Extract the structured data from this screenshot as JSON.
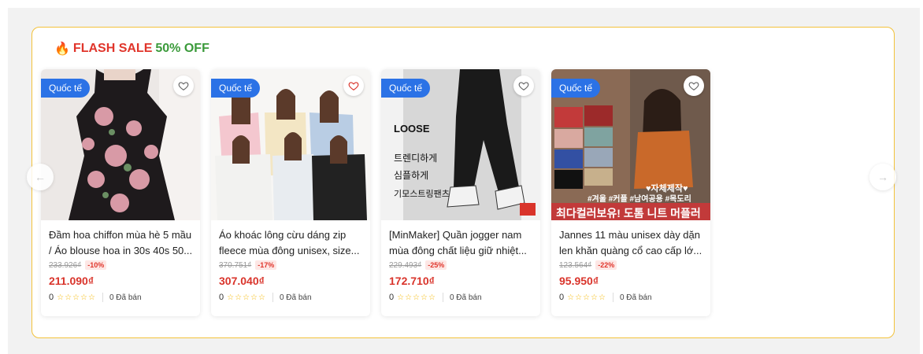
{
  "flash_sale": {
    "fire_icon": "🔥",
    "title_red": "FLASH SALE",
    "title_green": "50% OFF",
    "prev_arrow": "←",
    "next_arrow": "→"
  },
  "colors": {
    "border": "#f3c23a",
    "red": "#e0352b",
    "green": "#3a9a3a",
    "badge": "#2b72e6"
  },
  "products": [
    {
      "badge": "Quốc tế",
      "name": "Đầm hoa chiffon mùa hè 5 mầu / Áo blouse hoa in 30s 40s 50...",
      "old_price": "233.926₫",
      "discount": "-10%",
      "price": "211.090₫",
      "rating": "0",
      "stars": "☆☆☆☆☆",
      "sold": "0 Đã bán",
      "image_text": []
    },
    {
      "badge": "Quốc tế",
      "name": "Áo khoác lông cừu dáng zip fleece mùa đông unisex, size...",
      "old_price": "370.751₫",
      "discount": "-17%",
      "price": "307.040₫",
      "rating": "0",
      "stars": "☆☆☆☆☆",
      "sold": "0 Đã bán",
      "image_text": []
    },
    {
      "badge": "Quốc tế",
      "name": "[MinMaker] Quần jogger nam mùa đông chất liệu giữ nhiệt...",
      "old_price": "229.493₫",
      "discount": "-25%",
      "price": "172.710₫",
      "rating": "0",
      "stars": "☆☆☆☆☆",
      "sold": "0 Đã bán",
      "image_text": [
        "LOOSE",
        "트렌디하게",
        "심플하게",
        "기모스트링팬츠"
      ]
    },
    {
      "badge": "Quốc tế",
      "name": "Jannes 11 màu unisex dày dặn len khăn quàng cổ cao cấp lớ...",
      "old_price": "123.564₫",
      "discount": "-22%",
      "price": "95.950₫",
      "rating": "0",
      "stars": "☆☆☆☆☆",
      "sold": "0 Đã bán",
      "image_text": [
        "♥자체제작♥",
        "#겨울 #커플 #남여공용 #목도리",
        "최다컬러보유! 도톰 니트 머플러"
      ]
    }
  ]
}
